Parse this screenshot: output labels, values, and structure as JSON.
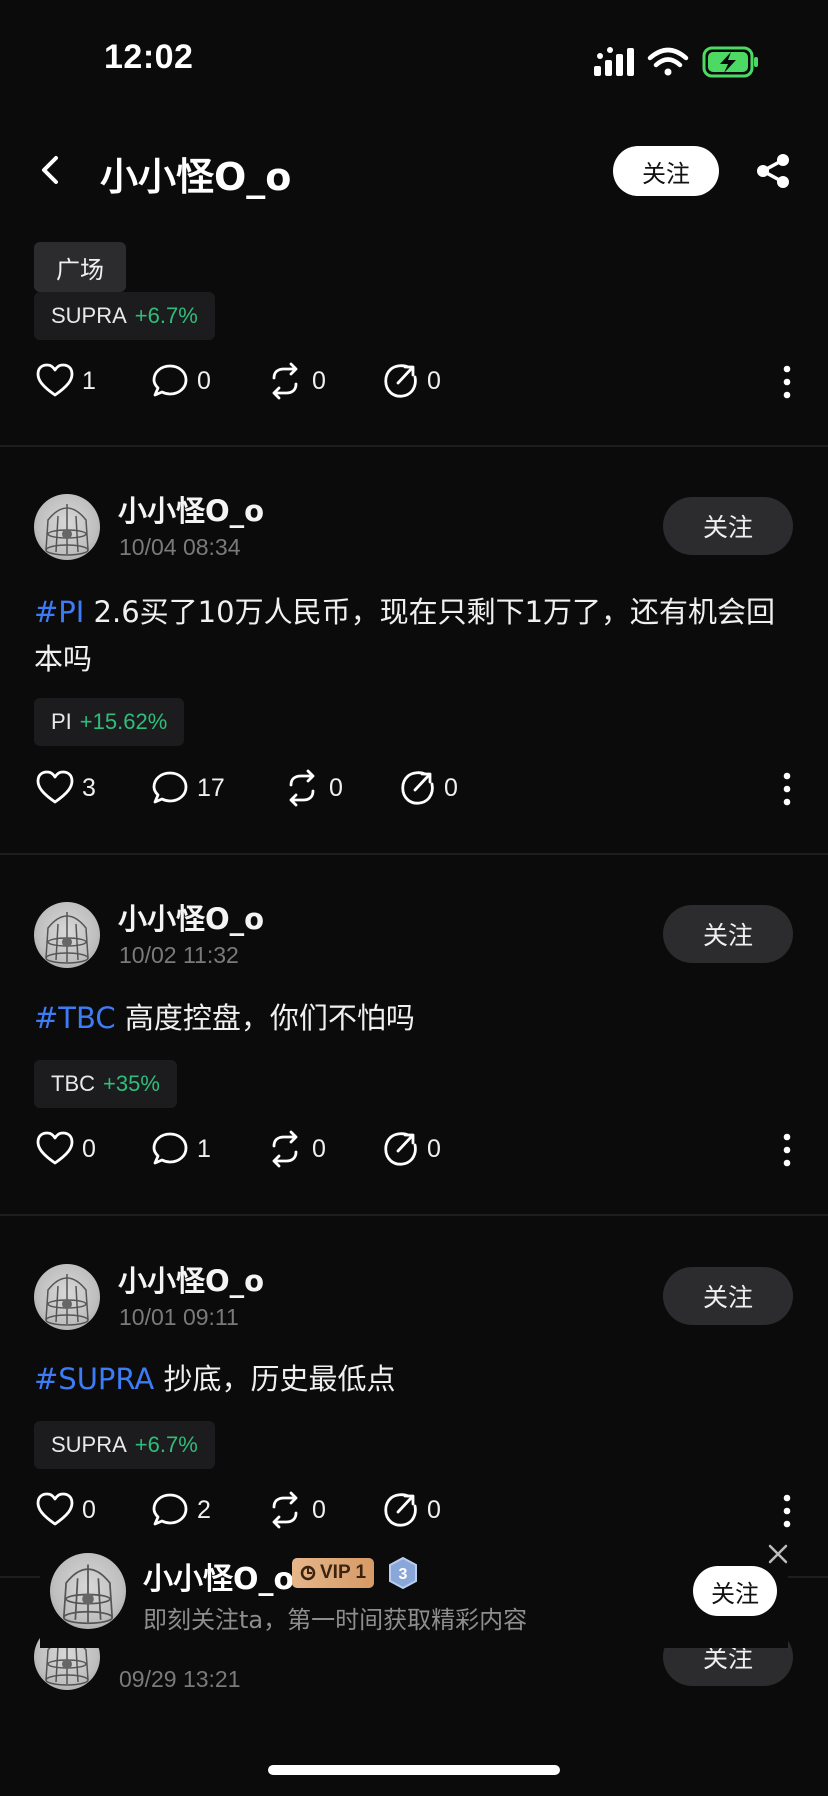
{
  "status_bar": {
    "time": "12:02"
  },
  "header": {
    "title": "小小怪O_o",
    "follow_label": "关注",
    "tag_label": "广场"
  },
  "first_post": {
    "chip": {
      "symbol": "SUPRA",
      "change": "+6.7%"
    },
    "likes": "1",
    "comments": "0",
    "reposts": "0",
    "shares": "0"
  },
  "posts": [
    {
      "author": "小小怪O_o",
      "time": "10/04 08:34",
      "follow_label": "关注",
      "hashtag": "#PI",
      "text": " 2.6买了10万人民币，现在只剩下1万了，还有机会回本吗",
      "chip": {
        "symbol": "PI",
        "change": "+15.62%"
      },
      "likes": "3",
      "comments": "17",
      "reposts": "0",
      "shares": "0"
    },
    {
      "author": "小小怪O_o",
      "time": "10/02 11:32",
      "follow_label": "关注",
      "hashtag": "#TBC",
      "text": " 高度控盘，你们不怕吗",
      "chip": {
        "symbol": "TBC",
        "change": "+35%"
      },
      "likes": "0",
      "comments": "1",
      "reposts": "0",
      "shares": "0"
    },
    {
      "author": "小小怪O_o",
      "time": "10/01 09:11",
      "follow_label": "关注",
      "hashtag": "#SUPRA",
      "text": " 抄底，历史最低点",
      "chip": {
        "symbol": "SUPRA",
        "change": "+6.7%"
      },
      "likes": "0",
      "comments": "2",
      "reposts": "0",
      "shares": "0"
    },
    {
      "author": "",
      "time": "09/29 13:21",
      "follow_label": "关注"
    }
  ],
  "popup": {
    "name": "小小怪O_o",
    "vip": "VIP 1",
    "level": "3",
    "subtitle": "即刻关注ta，第一时间获取精彩内容",
    "follow_label": "关注"
  },
  "colors": {
    "background": "#0b0b0b",
    "hashtag": "#3d7bf7",
    "positive": "#2fbd7a",
    "battery": "#4cd964"
  }
}
